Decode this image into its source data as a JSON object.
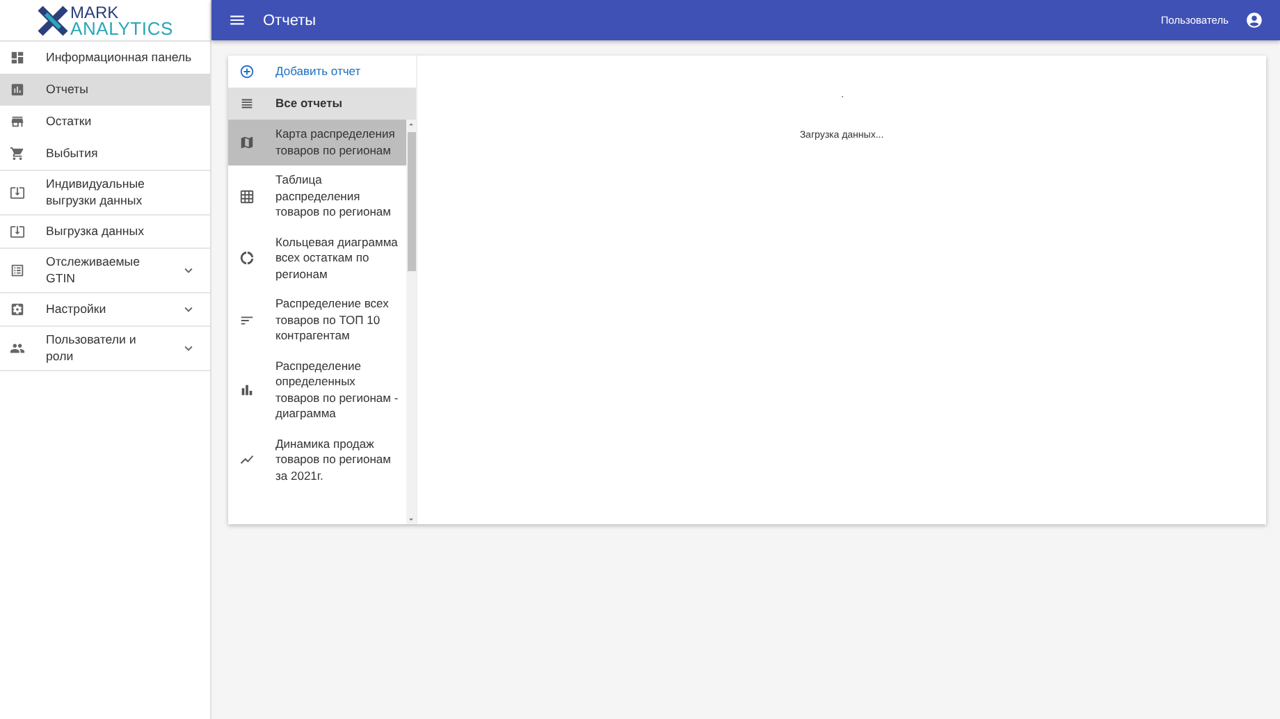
{
  "logo": {
    "line_1": "MARK",
    "line_2": "ANALYTICS"
  },
  "sidebar": {
    "items": [
      {
        "label": "Информационная панель",
        "selected": false,
        "expandable": false,
        "divider": false
      },
      {
        "label": "Отчеты",
        "selected": true,
        "expandable": false,
        "divider": false
      },
      {
        "label": "Остатки",
        "selected": false,
        "expandable": false,
        "divider": false
      },
      {
        "label": "Выбытия",
        "selected": false,
        "expandable": false,
        "divider": true
      },
      {
        "label": "Индивидуальные выгрузки данных",
        "selected": false,
        "expandable": false,
        "divider": true
      },
      {
        "label": "Выгрузка данных",
        "selected": false,
        "expandable": false,
        "divider": true
      },
      {
        "label": "Отслеживаемые GTIN",
        "selected": false,
        "expandable": true,
        "divider": true
      },
      {
        "label": "Настройки",
        "selected": false,
        "expandable": true,
        "divider": true
      },
      {
        "label": "Пользователи и роли",
        "selected": false,
        "expandable": true,
        "divider": true
      }
    ]
  },
  "header": {
    "title": "Отчеты",
    "user": "Пользователь"
  },
  "reports": {
    "add": "Добавить отчет",
    "all": "Все отчеты",
    "items": [
      {
        "label": "Карта распределения товаров по регионам",
        "selected": true
      },
      {
        "label": "Таблица распределения товаров по регионам",
        "selected": false
      },
      {
        "label": "Кольцевая диаграмма всех остаткам по регионам",
        "selected": false
      },
      {
        "label": "Распределение всех товаров по ТОП 10 контрагентам",
        "selected": false
      },
      {
        "label": "Распределение определенных товаров по регионам - диаграмма",
        "selected": false
      },
      {
        "label": "Динамика продаж товаров по регионам за 2021г.",
        "selected": false
      }
    ]
  },
  "content": {
    "loading": "Загрузка данных..."
  }
}
